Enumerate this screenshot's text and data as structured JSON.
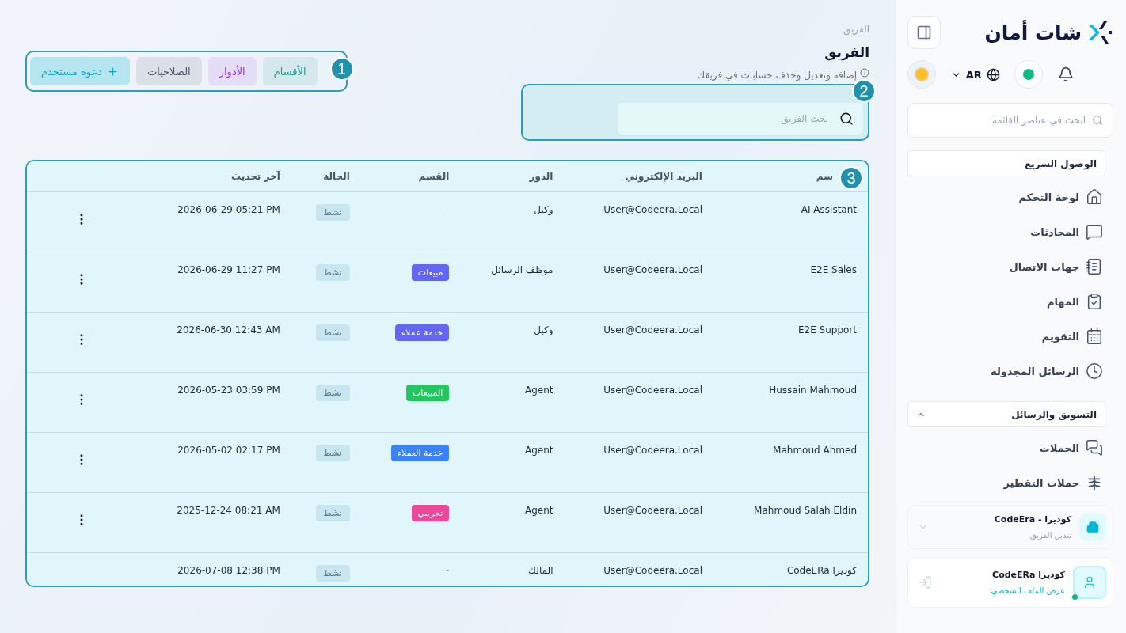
{
  "sidebar": {
    "logo": "شات أمان",
    "language": "AR",
    "online": true,
    "search": {
      "placeholder": "ابحث في عناصر القائمة"
    },
    "sections": [
      {
        "title": "الوصول السريع",
        "kind": "plain",
        "items": [
          "لوحة التحكم",
          "المحادثات",
          "جهات الاتصال",
          "المهام",
          "التقويم",
          "الرسائل المجدولة"
        ]
      },
      {
        "title": "التسويق والرسائل",
        "kind": "collapsible",
        "expanded": true,
        "items": [
          "الحملات",
          "حملات التقطير"
        ]
      }
    ],
    "team": {
      "name": "كوديرا - CodeEra",
      "action": "تبديل الفريق"
    },
    "profile": {
      "name": "كوديرا CodeERa",
      "action": "عرض الملف الشخصي",
      "online": true
    }
  },
  "page": {
    "breadcrumb": "الفريق",
    "title": "الفريق",
    "description": "إضافة وتعديل وحذف حسابات في فريقك",
    "search": {
      "placeholder": "بحث الفريق"
    },
    "tabs": [
      {
        "label": "الأقسام",
        "color": "#16a394"
      },
      {
        "label": "الأدوار",
        "color": "#9333ea"
      },
      {
        "label": "الصلاحيات",
        "color": "#4b5563"
      }
    ],
    "invite_button": "دعوة مستخدم"
  },
  "callouts": [
    "1",
    "2",
    "3"
  ],
  "table": {
    "columns": [
      "سم",
      "البريد الإلكتروني",
      "الدور",
      "القسم",
      "الحالة",
      "آخر تحديث"
    ],
    "rows": [
      {
        "name": "AI Assistant",
        "email": "User@Codeera.Local",
        "role": "وكيل",
        "department": {
          "label": "-",
          "kind": "empty"
        },
        "status": "نشط",
        "updated": "2026-06-29 05:21 PM",
        "has_menu": true
      },
      {
        "name": "E2E Sales",
        "email": "User@Codeera.Local",
        "role": "موظف الرسائل",
        "department": {
          "label": "مبيعات",
          "kind": "tag",
          "color": "#6366f1"
        },
        "status": "نشط",
        "updated": "2026-06-29 11:27 PM",
        "has_menu": true
      },
      {
        "name": "E2E Support",
        "email": "User@Codeera.Local",
        "role": "وكيل",
        "department": {
          "label": "خدمة عملاء",
          "kind": "tag",
          "color": "#6366f1"
        },
        "status": "نشط",
        "updated": "2026-06-30 12:43 AM",
        "has_menu": true
      },
      {
        "name": "Hussain Mahmoud",
        "email": "User@Codeera.Local",
        "role": "Agent",
        "department": {
          "label": "المبيعات",
          "kind": "tag",
          "color": "#22c55e"
        },
        "status": "نشط",
        "updated": "2026-05-23 03:59 PM",
        "has_menu": true
      },
      {
        "name": "Mahmoud Ahmed",
        "email": "User@Codeera.Local",
        "role": "Agent",
        "department": {
          "label": "خدمة العملاء",
          "kind": "tag",
          "color": "#3b82f6"
        },
        "status": "نشط",
        "updated": "2026-05-02 02:17 PM",
        "has_menu": true
      },
      {
        "name": "Mahmoud Salah Eldin",
        "email": "User@Codeera.Local",
        "role": "Agent",
        "department": {
          "label": "تجريبي",
          "kind": "tag",
          "color": "#ec4899"
        },
        "status": "نشط",
        "updated": "2025-12-24 08:21 AM",
        "has_menu": true
      },
      {
        "name": "كوديرا CodeERa",
        "email": "User@Codeera.Local",
        "role": "المالك",
        "department": {
          "label": "-",
          "kind": "empty"
        },
        "status": "نشط",
        "updated": "2026-07-08 12:38 PM",
        "has_menu": false
      }
    ]
  }
}
